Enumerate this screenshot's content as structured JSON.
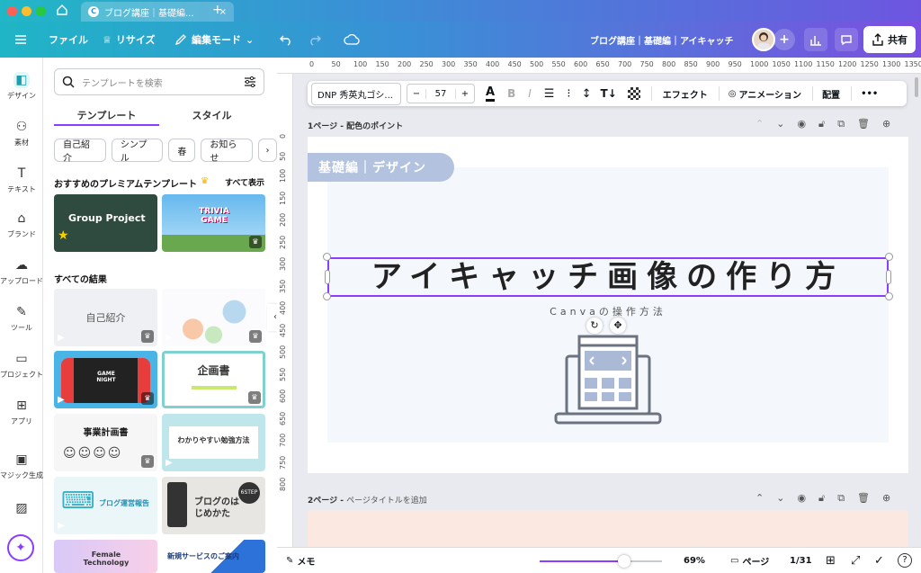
{
  "browser": {
    "tab_title": "ブログ講座｜基礎編...",
    "tab_close": "×",
    "new_tab": "+",
    "traffic_colors": [
      "#ff5f57",
      "#febc2e",
      "#28c840"
    ]
  },
  "toolbar": {
    "file": "ファイル",
    "resize": "リサイズ",
    "edit_mode": "編集モード",
    "doc_title": "ブログ講座｜基礎編｜アイキャッチ",
    "share": "共有"
  },
  "rail": {
    "items": [
      {
        "label": "デザイン",
        "icon": "design-icon"
      },
      {
        "label": "素材",
        "icon": "elements-icon"
      },
      {
        "label": "テキスト",
        "icon": "text-icon"
      },
      {
        "label": "ブランド",
        "icon": "brand-icon"
      },
      {
        "label": "アップロード",
        "icon": "upload-icon"
      },
      {
        "label": "ツール",
        "icon": "tools-icon"
      },
      {
        "label": "プロジェクト",
        "icon": "folder-icon"
      },
      {
        "label": "アプリ",
        "icon": "apps-icon"
      },
      {
        "label": "マジック生成",
        "icon": "magic-icon"
      }
    ]
  },
  "panel": {
    "search_placeholder": "テンプレートを検索",
    "tabs": [
      "テンプレート",
      "スタイル"
    ],
    "chips": [
      "自己紹介",
      "シンプル",
      "春",
      "お知らせ"
    ],
    "premium_title": "おすすめのプレミアムテンプレート",
    "see_all": "すべて表示",
    "all_results": "すべての結果",
    "thumb_texts": {
      "group_project": "Group Project",
      "trivia": "TRIVIA GAME",
      "self_intro": "自己紹介",
      "game_night": "GAME NIGHT",
      "kikakusho": "企画書",
      "jigyo": "事業計画書",
      "benkyo": "わかりやすい勉強方法",
      "blog_report": "ブログ運営報告",
      "blog_hajime": "ブログのはじめかた",
      "female": "Female Technology",
      "new_service": "新規サービスのご案内",
      "sixstep": "6STEP"
    }
  },
  "textbar": {
    "font": "DNP 秀英丸ゴシ...",
    "minus": "−",
    "size": "57",
    "plus": "+",
    "effect": "エフェクト",
    "animation": "アニメーション",
    "position": "配置",
    "more": "•••"
  },
  "ruler": {
    "h": [
      "0",
      "50",
      "100",
      "150",
      "200",
      "250",
      "300",
      "350",
      "400",
      "450",
      "500",
      "550",
      "600",
      "650",
      "700",
      "750",
      "800",
      "850",
      "900",
      "950",
      "1000",
      "1050",
      "1100",
      "1150",
      "1200",
      "1250",
      "1300",
      "1350"
    ],
    "v": [
      "0",
      "50",
      "100",
      "150",
      "200",
      "250",
      "300",
      "350",
      "400",
      "450",
      "500",
      "550",
      "600",
      "650",
      "700",
      "750",
      "800"
    ]
  },
  "page1": {
    "label": "1ページ - 配色のポイント",
    "tag": "基礎編｜デザイン",
    "headline": "アイキャッチ画像の作り方",
    "subtitle": "Canvaの操作方法"
  },
  "page2": {
    "label_bold": "2ページ - ",
    "label_rest": "ページタイトルを追加"
  },
  "status": {
    "notes": "メモ",
    "zoom": "69%",
    "zoom_fraction": 0.69,
    "pages_label": "ページ",
    "page_count": "1/31"
  },
  "colors": {
    "accent": "#8b3dff",
    "tag_bg": "#b3c3df",
    "headline": "#222222",
    "page2_bg": "#fbe9e1",
    "illustration": "#6b7280",
    "illustration_fill": "#a9b9d6"
  }
}
